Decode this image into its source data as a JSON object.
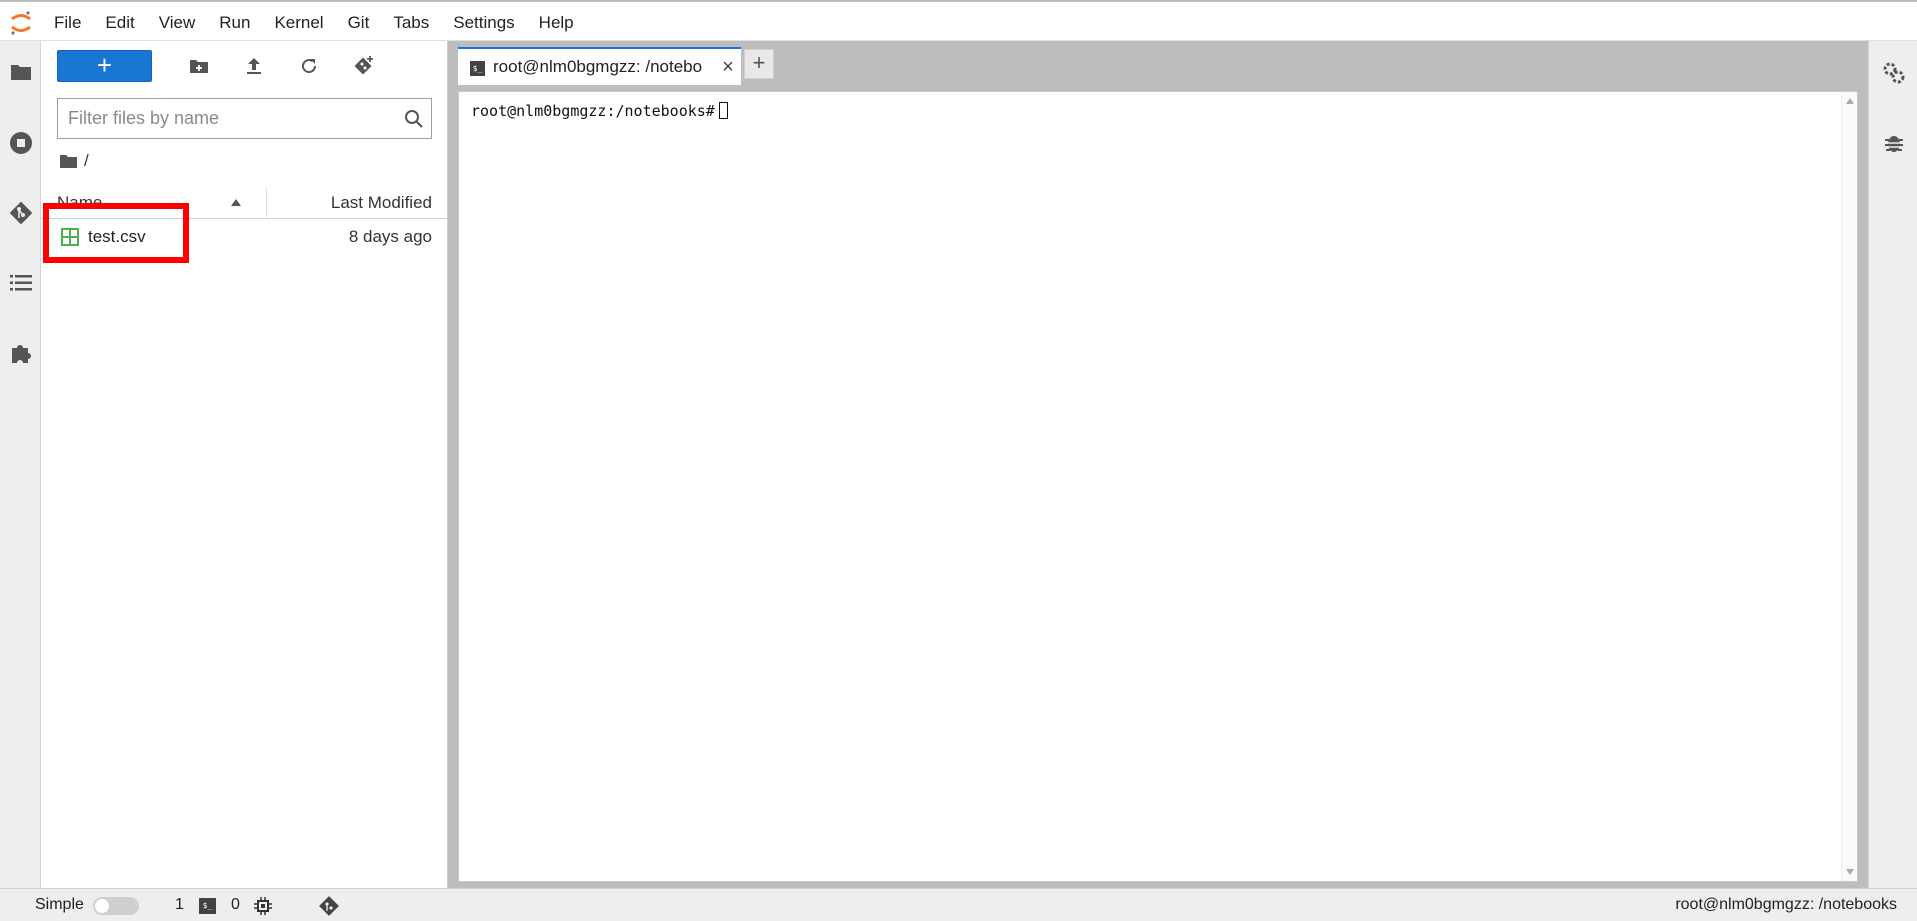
{
  "menubar": {
    "items": [
      "File",
      "Edit",
      "View",
      "Run",
      "Kernel",
      "Git",
      "Tabs",
      "Settings",
      "Help"
    ]
  },
  "left_sidebar": {
    "icons": [
      "folder-icon",
      "running-sessions-icon",
      "git-icon",
      "table-of-contents-icon",
      "extension-icon"
    ]
  },
  "filebrowser": {
    "new_button_label": "+",
    "filter_placeholder": "Filter files by name",
    "breadcrumb_path": "/",
    "columns": {
      "name": "Name",
      "modified": "Last Modified"
    },
    "files": [
      {
        "name": "test.csv",
        "modified": "8 days ago",
        "type": "csv"
      }
    ]
  },
  "tabs": {
    "active_label": "root@nlm0bgmgzz: /notebo",
    "add_label": "+",
    "close_label": "×"
  },
  "terminal": {
    "prompt": "root@nlm0bgmgzz:/notebooks#"
  },
  "statusbar": {
    "mode_label": "Simple",
    "kernel_count": "1",
    "terminal_count": "0",
    "right_text": "root@nlm0bgmgzz: /notebooks"
  },
  "colors": {
    "accent": "#1976d2",
    "highlight": "#ff0000",
    "logo": "#f37726",
    "csv_icon": "#4caf50"
  }
}
